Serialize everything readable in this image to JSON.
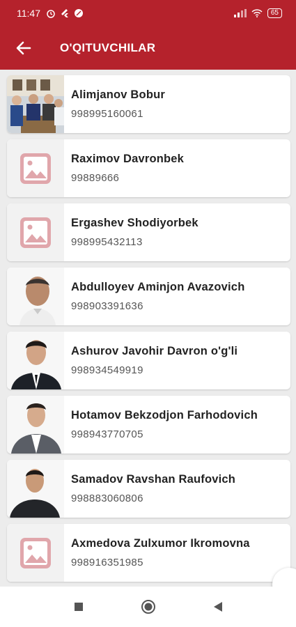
{
  "status_bar": {
    "time": "11:47",
    "battery": "65"
  },
  "app_bar": {
    "title": "O'QITUVCHILAR"
  },
  "teachers": [
    {
      "name": "Alimjanov Bobur",
      "phone": "998995160061",
      "photo": "group-photo"
    },
    {
      "name": "Raximov Davronbek",
      "phone": "99889666",
      "photo": "placeholder-image-icon"
    },
    {
      "name": "Ergashev Shodiyorbek",
      "phone": "998995432113",
      "photo": "placeholder-image-icon"
    },
    {
      "name": "Abdulloyev Aminjon Avazovich",
      "phone": "998903391636",
      "photo": "portrait-photo"
    },
    {
      "name": "Ashurov Javohir Davron o'g'li",
      "phone": "998934549919",
      "photo": "portrait-photo"
    },
    {
      "name": "Hotamov Bekzodjon Farhodovich",
      "phone": "998943770705",
      "photo": "portrait-photo"
    },
    {
      "name": "Samadov Ravshan Raufovich",
      "phone": "998883060806",
      "photo": "portrait-photo"
    },
    {
      "name": "Axmedova Zulxumor Ikromovna",
      "phone": "998916351985",
      "photo": "placeholder-image-icon"
    }
  ],
  "colors": {
    "header": "#b5222c",
    "placeholder": "#e0a6ab",
    "background": "#ececec"
  }
}
